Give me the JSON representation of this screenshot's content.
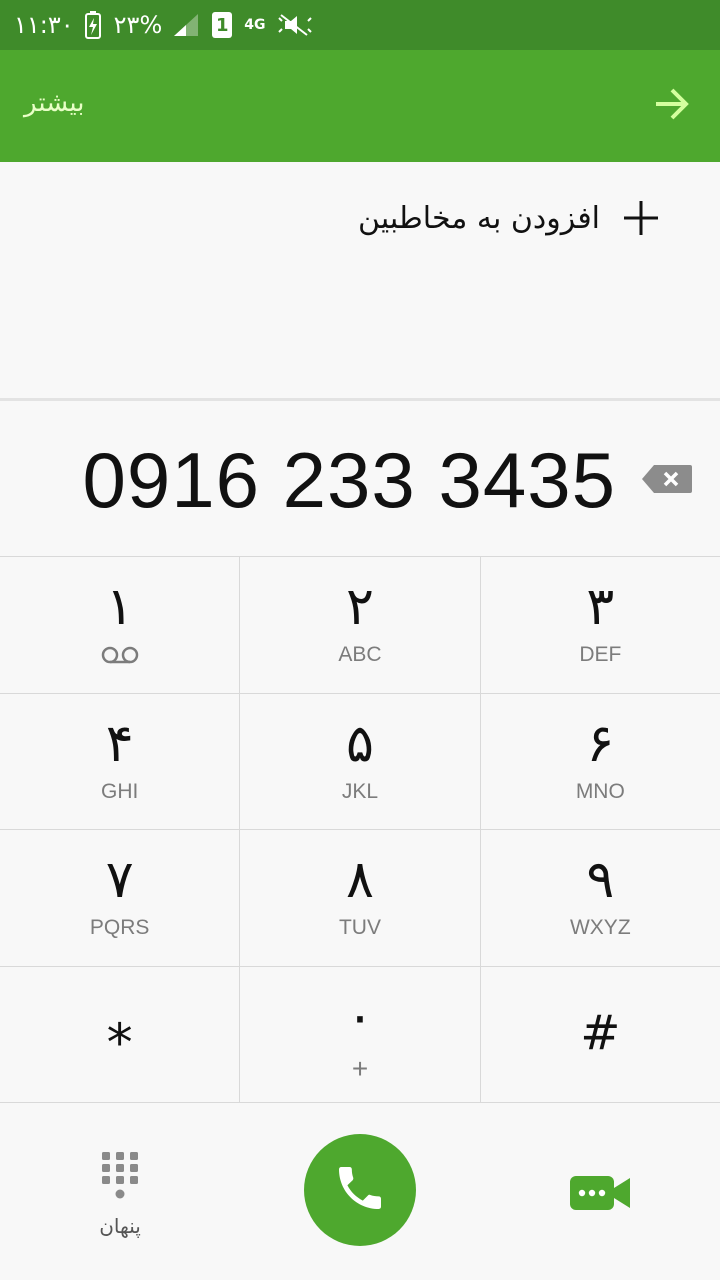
{
  "status_bar": {
    "time": "۱۱:۳۰",
    "battery": "۲۳%",
    "sim_slot": "1",
    "network": "4G"
  },
  "app_bar": {
    "more_label": "بیشتر"
  },
  "add_contact": {
    "label": "افزودن به مخاطبین"
  },
  "dialer": {
    "number": "0916 233 3435"
  },
  "keypad": {
    "keys": [
      {
        "digit": "۱",
        "sub": ""
      },
      {
        "digit": "۲",
        "sub": "ABC"
      },
      {
        "digit": "۳",
        "sub": "DEF"
      },
      {
        "digit": "۴",
        "sub": "GHI"
      },
      {
        "digit": "۵",
        "sub": "JKL"
      },
      {
        "digit": "۶",
        "sub": "MNO"
      },
      {
        "digit": "۷",
        "sub": "PQRS"
      },
      {
        "digit": "۸",
        "sub": "TUV"
      },
      {
        "digit": "۹",
        "sub": "WXYZ"
      },
      {
        "digit": "⁎",
        "sub": ""
      },
      {
        "digit": "۰",
        "sub": "+"
      },
      {
        "digit": "#",
        "sub": ""
      }
    ]
  },
  "bottom_bar": {
    "hide_label": "پنهان"
  },
  "colors": {
    "status_bar": "#3f8b2a",
    "app_bar": "#4ea82e",
    "accent": "#4ea82e",
    "more_text": "#e9ffc7"
  },
  "icons": {
    "forward": "arrow-right-icon",
    "add": "plus-icon",
    "backspace": "backspace-icon",
    "voicemail": "voicemail-icon",
    "keypad": "dialpad-icon",
    "call": "phone-icon",
    "video": "video-call-icon"
  }
}
